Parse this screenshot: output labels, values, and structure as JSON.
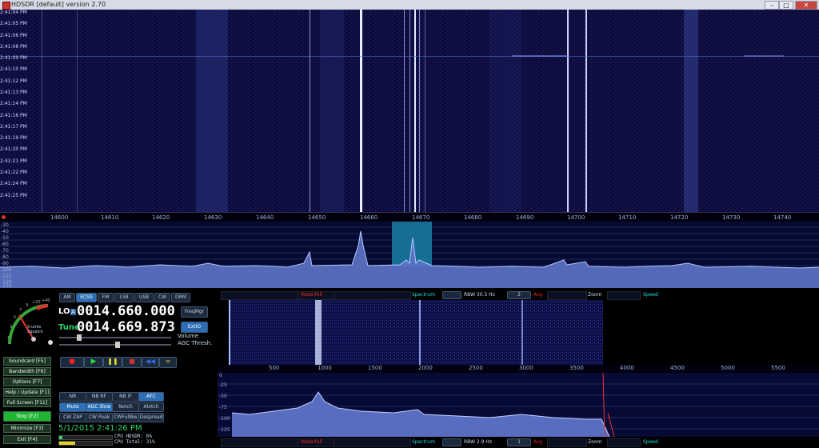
{
  "window": {
    "title": "HDSDR [default]  version 2.70",
    "minimize_glyph": "–",
    "maximize_glyph": "□",
    "close_glyph": "✕"
  },
  "waterfall": {
    "timestamps": [
      "2:41:04 PM",
      "2:41:05 PM",
      "2:41:06 PM",
      "2:41:08 PM",
      "2:41:09 PM",
      "2:41:10 PM",
      "2:41:12 PM",
      "2:41:13 PM",
      "2:41:14 PM",
      "2:41:16 PM",
      "2:41:17 PM",
      "2:41:19 PM",
      "2:41:20 PM",
      "2:41:21 PM",
      "2:41:22 PM",
      "2:41:24 PM",
      "2:41:25 PM"
    ]
  },
  "freq_scale": {
    "labels": [
      "14600",
      "14610",
      "14620",
      "14630",
      "14640",
      "14650",
      "14660",
      "14670",
      "14680",
      "14690",
      "14700",
      "14710",
      "14720",
      "14730",
      "14740"
    ]
  },
  "spectrum": {
    "db_labels": [
      "-30",
      "-40",
      "-50",
      "-60",
      "-70",
      "-80",
      "-90",
      "-100",
      "-110",
      "-120",
      "-130"
    ]
  },
  "smeter": {
    "label": "S-units\nSquelch",
    "scale": [
      "1",
      "3",
      "5",
      "7",
      "9",
      "+20",
      "+40"
    ]
  },
  "modes": [
    "AM",
    "ECSS",
    "FM",
    "LSB",
    "USB",
    "CW",
    "DRM"
  ],
  "lo": {
    "label": "LO",
    "badge": "A",
    "value": "0014.660.000"
  },
  "tune": {
    "label": "Tune",
    "value": "0014.669.873"
  },
  "buttons": {
    "freqmgr": "FreqMgr",
    "extio": "ExtIO",
    "volume": "Volume",
    "agc_thresh": "AGC Thresh."
  },
  "left_menu": [
    "Soundcard  [F5]",
    "Bandwidth  [F6]",
    "Options  [F7]",
    "Help / Update  [F1]",
    "Full Screen  [F11]",
    "Stop  [F2]",
    "Minimize  [F3]",
    "Exit  [F4]"
  ],
  "dsp": {
    "row1": [
      "NR",
      "NB RF",
      "NB IF",
      "AFC"
    ],
    "row2": [
      "Mute",
      "AGC Slow",
      "Notch",
      "Alotch"
    ],
    "row3": [
      "CW ZAP",
      "CW Peak",
      "CWFullBw",
      "Despread"
    ]
  },
  "status": {
    "datetime": "5/1/2015 2:41:26 PM",
    "cpu_hdsdr": "CPU HDSDR: 6%",
    "cpu_total": "CPU Total: 31%"
  },
  "top_controls": {
    "waterfall": "Waterfall",
    "spectrum": "Spectrum",
    "rbw": "RBW 30.5 Hz",
    "rbw_select": "2",
    "avg": "Avg",
    "zoom": "Zoom",
    "speed": "Speed"
  },
  "bottom_controls": {
    "waterfall": "Waterfall",
    "spectrum": "Spectrum",
    "rbw": "RBW 2.9 Hz",
    "rbw_select": "1",
    "avg": "Avg",
    "zoom": "Zoom",
    "speed": "Speed"
  },
  "af_scale": {
    "labels": [
      "500",
      "1000",
      "1500",
      "2000",
      "2500",
      "3000",
      "3500",
      "4000",
      "4500",
      "5000",
      "5500"
    ]
  },
  "af_db_labels": [
    "0",
    "-25",
    "-50",
    "-75",
    "-100",
    "-125"
  ],
  "colors": {
    "waterfall_bg": "#0e0c3c",
    "spectrum_fill": "#5d73c8",
    "filter_highlight": "#1a7fa6",
    "freq_display": "#ffffff",
    "accent_blue": "#2d6fb5",
    "stop_green": "#1fb634"
  }
}
